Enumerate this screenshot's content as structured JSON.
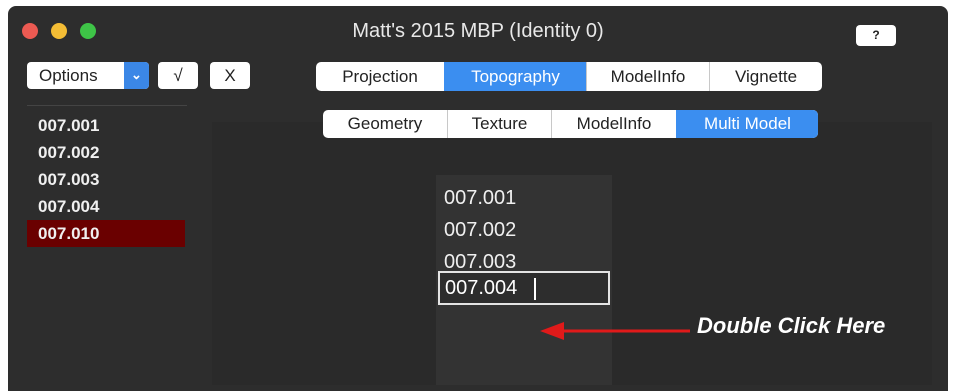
{
  "window": {
    "title": "Matt's 2015 MBP (Identity 0)",
    "help_label": "?"
  },
  "toolbar": {
    "options_label": "Options",
    "options_arrow": "⌄",
    "check_label": "√",
    "x_label": "X"
  },
  "tabs_primary": [
    {
      "label": "Projection",
      "active": false
    },
    {
      "label": "Topography",
      "active": true
    },
    {
      "label": "ModelInfo",
      "active": false
    },
    {
      "label": "Vignette",
      "active": false
    }
  ],
  "tabs_secondary": [
    {
      "label": "Geometry",
      "active": false
    },
    {
      "label": "Texture",
      "active": false
    },
    {
      "label": "ModelInfo",
      "active": false
    },
    {
      "label": "Multi Model",
      "active": true
    }
  ],
  "left_list": [
    {
      "label": "007.001",
      "selected": false
    },
    {
      "label": "007.002",
      "selected": false
    },
    {
      "label": "007.003",
      "selected": false
    },
    {
      "label": "007.004",
      "selected": false
    },
    {
      "label": "007.010",
      "selected": true
    }
  ],
  "multi_list": [
    "007.001",
    "007.002",
    "007.003"
  ],
  "edit_field": {
    "value": "007.004"
  },
  "annotation": {
    "text": "Double Click Here",
    "color": "#e01a1a"
  },
  "colors": {
    "accent": "#3b8ef0",
    "selection": "#6a0000",
    "background": "#2d2d2d"
  }
}
